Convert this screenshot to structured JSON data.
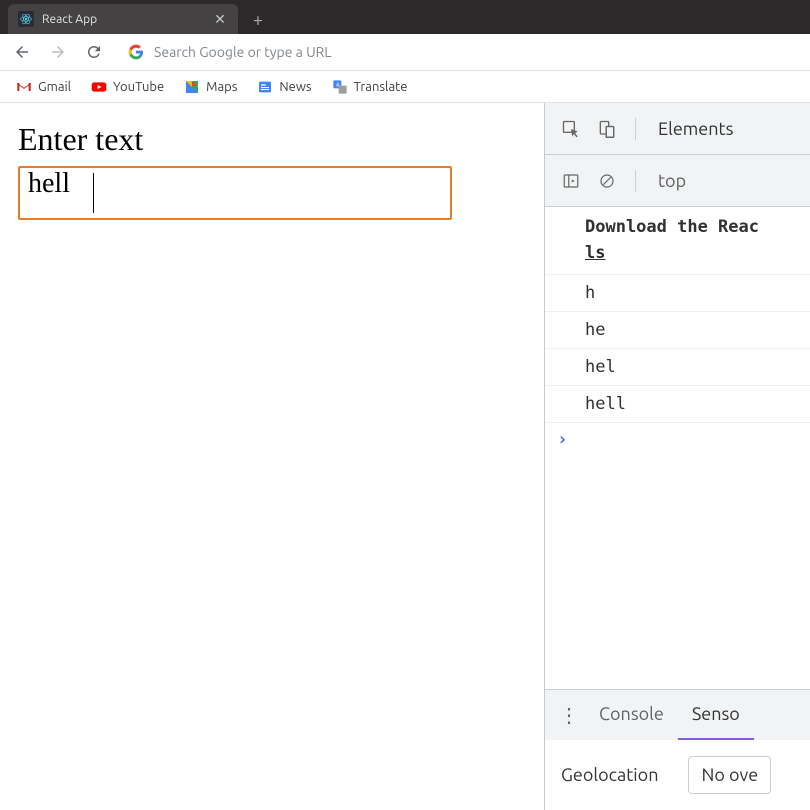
{
  "browser": {
    "tab_title": "React App",
    "address_placeholder": "Search Google or type a URL",
    "bookmarks": [
      {
        "label": "Gmail"
      },
      {
        "label": "YouTube"
      },
      {
        "label": "Maps"
      },
      {
        "label": "News"
      },
      {
        "label": "Translate"
      }
    ]
  },
  "page": {
    "heading": "Enter text",
    "input_value": "hell"
  },
  "devtools": {
    "main_tab": "Elements",
    "context": "top",
    "first_message_line1": "Download the Reac",
    "first_message_line2": "ls",
    "log_entries": [
      "h",
      "he",
      "hel",
      "hell"
    ],
    "drawer_tabs": {
      "console": "Console",
      "sensors": "Senso"
    },
    "geo_label": "Geolocation",
    "geo_value": "No ove"
  }
}
